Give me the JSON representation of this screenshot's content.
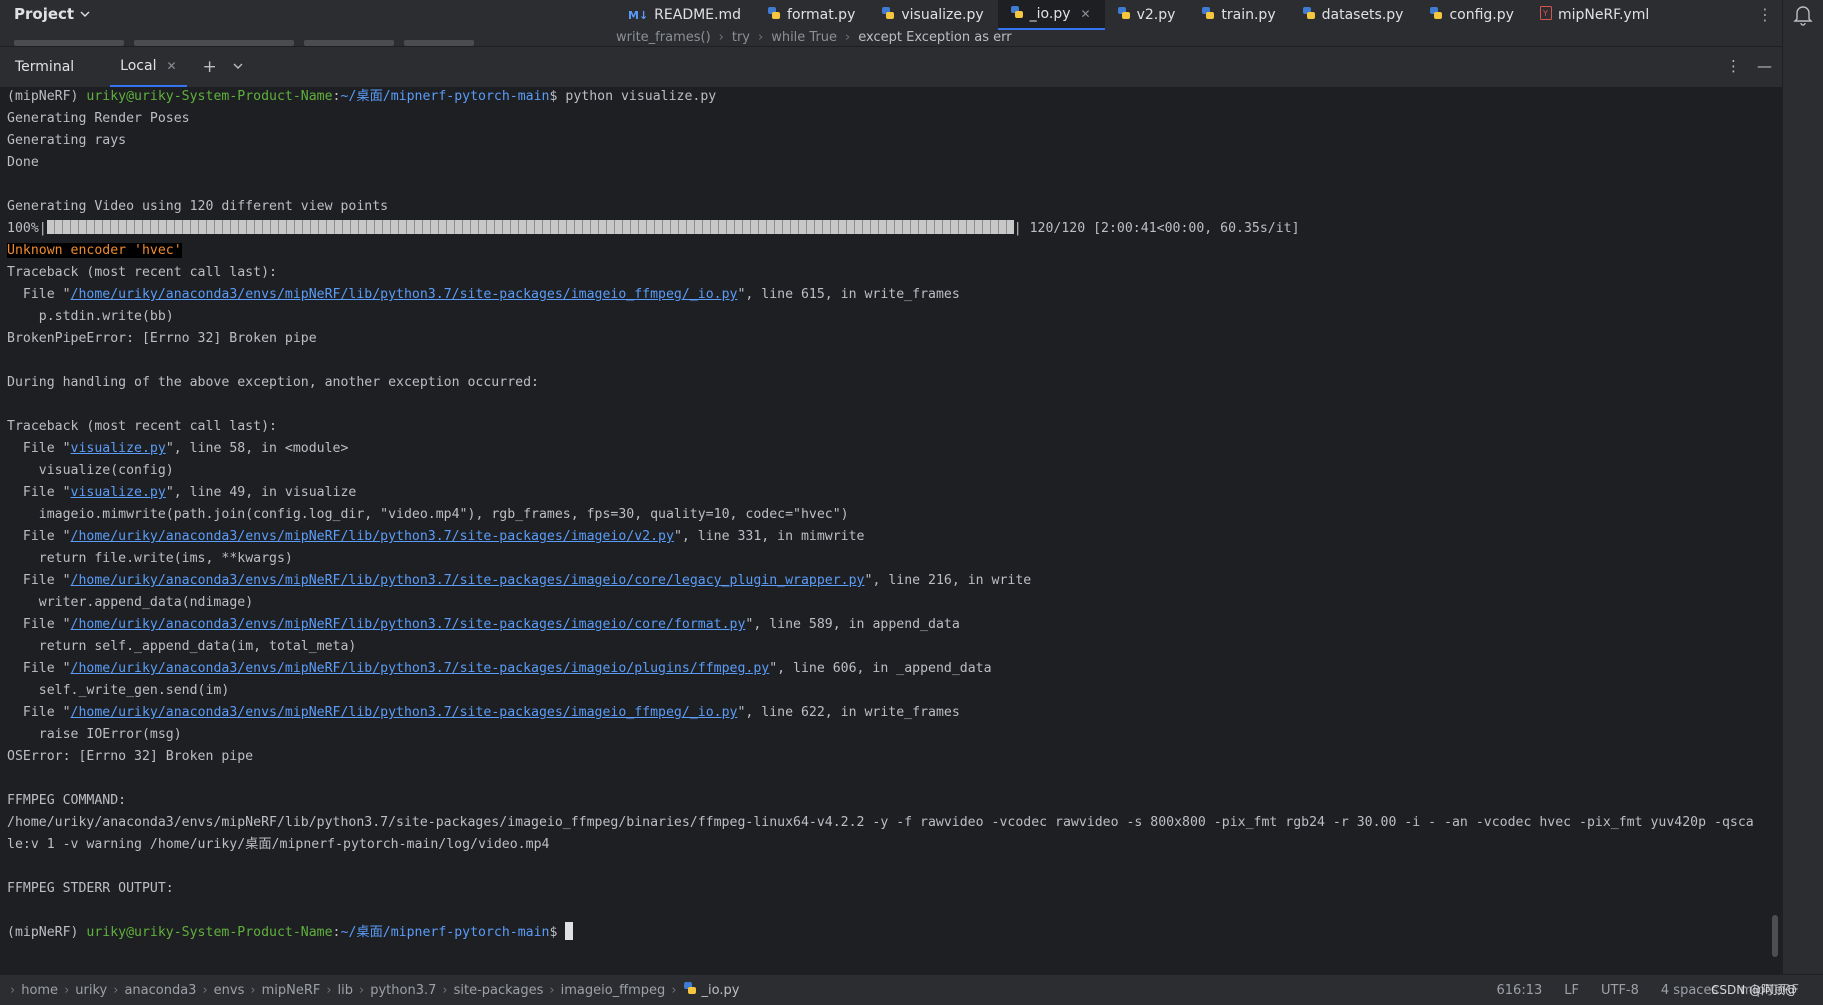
{
  "project": {
    "label": "Project"
  },
  "editor_tabs": [
    {
      "label": "README.md",
      "icon": "markdown-icon"
    },
    {
      "label": "format.py",
      "icon": "python-icon"
    },
    {
      "label": "visualize.py",
      "icon": "python-icon"
    },
    {
      "label": "_io.py",
      "icon": "python-icon",
      "active": true
    },
    {
      "label": "v2.py",
      "icon": "python-icon"
    },
    {
      "label": "train.py",
      "icon": "python-icon"
    },
    {
      "label": "datasets.py",
      "icon": "python-icon"
    },
    {
      "label": "config.py",
      "icon": "python-icon"
    },
    {
      "label": "mipNeRF.yml",
      "icon": "yaml-icon"
    }
  ],
  "code_breadcrumb": [
    "write_frames()",
    "try",
    "while True",
    "except Exception as err"
  ],
  "terminal": {
    "title": "Terminal",
    "tab_label": "Local",
    "prompt": {
      "env": "(mipNeRF) ",
      "user_host": "uriky@uriky-System-Product-Name",
      "colon": ":",
      "path": "~/桌面/mipnerf-pytorch-main",
      "dollar": "$ "
    },
    "command": "python visualize.py",
    "output": {
      "l1": "Generating Render Poses",
      "l2": "Generating rays",
      "l3": "Done",
      "l4": "Generating Video using 120 different view points",
      "progress_pct": "100%",
      "progress_fraction": 1.0,
      "progress_suffix": "| 120/120 [2:00:41<00:00, 60.35s/it]",
      "err_highlight": "Unknown encoder 'hvec'",
      "tb1_head": "Traceback (most recent call last):",
      "tb1_f1_file": "/home/uriky/anaconda3/envs/mipNeRF/lib/python3.7/site-packages/imageio_ffmpeg/_io.py",
      "tb1_f1_rest": "\", line 615, in write_frames",
      "tb1_f1_code": "p.stdin.write(bb)",
      "tb1_err": "BrokenPipeError: [Errno 32] Broken pipe",
      "during": "During handling of the above exception, another exception occurred:",
      "tb2_head": "Traceback (most recent call last):",
      "f1_file": "visualize.py",
      "f1_rest": "\", line 58, in <module>",
      "f1_code": "visualize(config)",
      "f2_file": "visualize.py",
      "f2_rest": "\", line 49, in visualize",
      "f2_code": "imageio.mimwrite(path.join(config.log_dir, \"video.mp4\"), rgb_frames, fps=30, quality=10, codec=\"hvec\")",
      "f3_file": "/home/uriky/anaconda3/envs/mipNeRF/lib/python3.7/site-packages/imageio/v2.py",
      "f3_rest": "\", line 331, in mimwrite",
      "f3_code": "return file.write(ims, **kwargs)",
      "f4_file": "/home/uriky/anaconda3/envs/mipNeRF/lib/python3.7/site-packages/imageio/core/legacy_plugin_wrapper.py",
      "f4_rest": "\", line 216, in write",
      "f4_code": "writer.append_data(ndimage)",
      "f5_file": "/home/uriky/anaconda3/envs/mipNeRF/lib/python3.7/site-packages/imageio/core/format.py",
      "f5_rest": "\", line 589, in append_data",
      "f5_code": "return self._append_data(im, total_meta)",
      "f6_file": "/home/uriky/anaconda3/envs/mipNeRF/lib/python3.7/site-packages/imageio/plugins/ffmpeg.py",
      "f6_rest": "\", line 606, in _append_data",
      "f6_code": "self._write_gen.send(im)",
      "f7_file": "/home/uriky/anaconda3/envs/mipNeRF/lib/python3.7/site-packages/imageio_ffmpeg/_io.py",
      "f7_rest": "\", line 622, in write_frames",
      "f7_code": "raise IOError(msg)",
      "oserror": "OSError: [Errno 32] Broken pipe",
      "ffmpeg_cmd_label": "FFMPEG COMMAND:",
      "ffmpeg_cmd_1": "/home/uriky/anaconda3/envs/mipNeRF/lib/python3.7/site-packages/imageio_ffmpeg/binaries/ffmpeg-linux64-v4.2.2 -y -f rawvideo -vcodec rawvideo -s 800x800 -pix_fmt rgb24 -r 30.00 -i - -an -vcodec hvec -pix_fmt yuv420p -qsca",
      "ffmpeg_cmd_2": "le:v 1 -v warning /home/uriky/桌面/mipnerf-pytorch-main/log/video.mp4",
      "ffmpeg_stderr_label": "FFMPEG STDERR OUTPUT:"
    },
    "file_prefix": "File \"",
    "quote": "\""
  },
  "status_path": [
    "home",
    "uriky",
    "anaconda3",
    "envs",
    "mipNeRF",
    "lib",
    "python3.7",
    "site-packages",
    "imageio_ffmpeg",
    "_io.py"
  ],
  "status": {
    "position": "616:13",
    "line_sep": "LF",
    "encoding": "UTF-8",
    "indent": "4 spaces",
    "interpreter": "mipNeRF",
    "watermark": "CSDN @阿顶@"
  },
  "colors": {
    "accent": "#3574f0",
    "prompt_green": "#5fb03d",
    "prompt_blue": "#5a9cf8",
    "error_orange": "#f08a30",
    "background": "#1e1f22"
  }
}
